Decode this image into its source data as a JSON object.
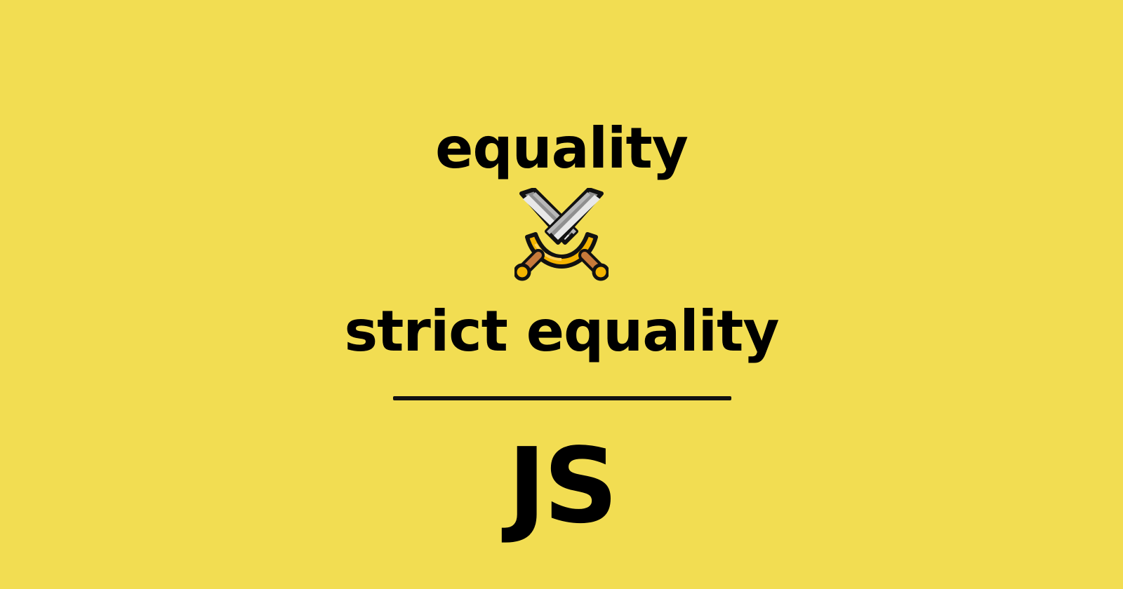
{
  "title_top": "equality",
  "title_bottom": "strict equality",
  "language_label": "JS",
  "icon": "crossed-swords-icon",
  "colors": {
    "background": "#f2dd52",
    "text": "#000000"
  }
}
